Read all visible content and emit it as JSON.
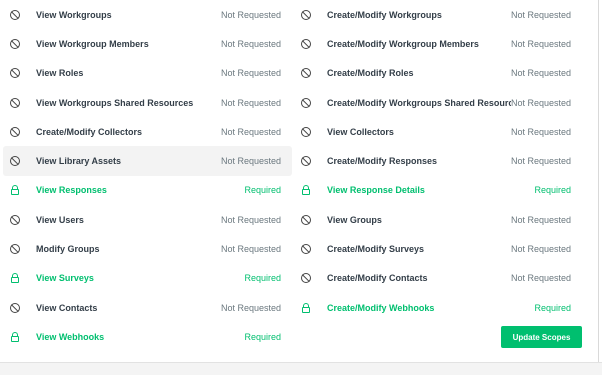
{
  "left_column": [
    {
      "label": "View Workgroups",
      "status": "Not Requested",
      "required": false
    },
    {
      "label": "View Workgroup Members",
      "status": "Not Requested",
      "required": false
    },
    {
      "label": "View Roles",
      "status": "Not Requested",
      "required": false
    },
    {
      "label": "View Workgroups Shared Resources",
      "status": "Not Requested",
      "required": false
    },
    {
      "label": "Create/Modify Collectors",
      "status": "Not Requested",
      "required": false
    },
    {
      "label": "View Library Assets",
      "status": "Not Requested",
      "required": false
    },
    {
      "label": "View Responses",
      "status": "Required",
      "required": true
    },
    {
      "label": "View Users",
      "status": "Not Requested",
      "required": false
    },
    {
      "label": "Modify Groups",
      "status": "Not Requested",
      "required": false
    },
    {
      "label": "View Surveys",
      "status": "Required",
      "required": true
    },
    {
      "label": "View Contacts",
      "status": "Not Requested",
      "required": false
    },
    {
      "label": "View Webhooks",
      "status": "Required",
      "required": true
    }
  ],
  "right_column": [
    {
      "label": "Create/Modify Workgroups",
      "status": "Not Requested",
      "required": false
    },
    {
      "label": "Create/Modify Workgroup Members",
      "status": "Not Requested",
      "required": false
    },
    {
      "label": "Create/Modify Roles",
      "status": "Not Requested",
      "required": false
    },
    {
      "label": "Create/Modify Workgroups Shared Resources",
      "status": "Not Requested",
      "required": false
    },
    {
      "label": "View Collectors",
      "status": "Not Requested",
      "required": false
    },
    {
      "label": "Create/Modify Responses",
      "status": "Not Requested",
      "required": false
    },
    {
      "label": "View Response Details",
      "status": "Required",
      "required": true
    },
    {
      "label": "View Groups",
      "status": "Not Requested",
      "required": false
    },
    {
      "label": "Create/Modify Surveys",
      "status": "Not Requested",
      "required": false
    },
    {
      "label": "Create/Modify Contacts",
      "status": "Not Requested",
      "required": false
    },
    {
      "label": "Create/Modify Webhooks",
      "status": "Required",
      "required": true
    }
  ],
  "update_button": {
    "label": "Update Scopes"
  },
  "highlighted_row": "View Library Assets",
  "icons": {
    "not_requested": "ban-icon",
    "required": "lock-icon"
  },
  "colors": {
    "required": "#00bf6f",
    "text": "#333e48",
    "muted": "#6b787f",
    "button": "#00bf6f"
  }
}
